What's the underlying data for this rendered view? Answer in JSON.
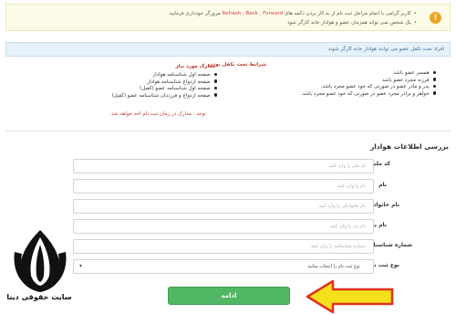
{
  "notice": {
    "lines": [
      {
        "before": "کاربر گرامی با اتمام مراحل ثبت نام از به کار بردن دکمه های ",
        "highlight": "Refresh , Back , Forward",
        "after": " مرورگر خودداری فرمایید"
      },
      {
        "before": "یک شخص نمی تواند همزمان عضو و هوادار خانه کارگر شود",
        "highlight": "",
        "after": ""
      }
    ],
    "badge": "!"
  },
  "info_bar": {
    "text": "افراد تحت تکفل عضو می توانند هوادار خانه کارگر شوند"
  },
  "conditions": {
    "title": "شرایط تحت تکفل بودن",
    "items": [
      "همسر عضو باشد",
      "فرزند مجرد عضو باشد",
      "پدر و مادر عضو در صورتی که خود عضو مجرد باشد.",
      "خواهر و برادر مجرد عضو در صورتی که خود عضو مجرد باشد."
    ]
  },
  "documents": {
    "title": "مدارک مورد نیاز",
    "items": [
      "صفحه اول شناسنامه هوادار",
      "صفحه ازدواج شناسنامه هوادار",
      "صفحه اول شناسنامه عضو (کفیل)",
      "صفحه ازدواج و فرزندان شناسنامه عضو (کفیل)"
    ],
    "note": "توجه : مدارک در زمان ثبت نام اخذ خواهد شد."
  },
  "form": {
    "section_title": "بررسی اطلاعات هوادار",
    "fields": [
      {
        "label": "کد ملی",
        "placeholder": "کد ملی را وارد کنید"
      },
      {
        "label": "نام",
        "placeholder": "نام را وارد کنید"
      },
      {
        "label": "نام خانوادگی",
        "placeholder": "نام خانوادگی را وارد کنید"
      },
      {
        "label": "نام پدر",
        "placeholder": "نام پدر را وارد کنید"
      },
      {
        "label": "شماره شناسنامه",
        "placeholder": "شماره شناسنامه را وارد کنید"
      }
    ],
    "select": {
      "label": "نوع ثبت نام",
      "selected": "نوع ثبت نام را انتخاب نمایید"
    },
    "submit_label": "ادامه"
  },
  "watermark": {
    "text": "سایت حقوقی دینا"
  },
  "colors": {
    "accent_green": "#52b765",
    "arrow_yellow": "#f4e11c",
    "arrow_red": "#e0321e",
    "title_red": "#c0392b"
  },
  "icons": {
    "warning": "warning-icon",
    "arrow": "arrow-left-icon",
    "caret": "chevron-down-icon",
    "logo": "tulip-logo-icon"
  }
}
